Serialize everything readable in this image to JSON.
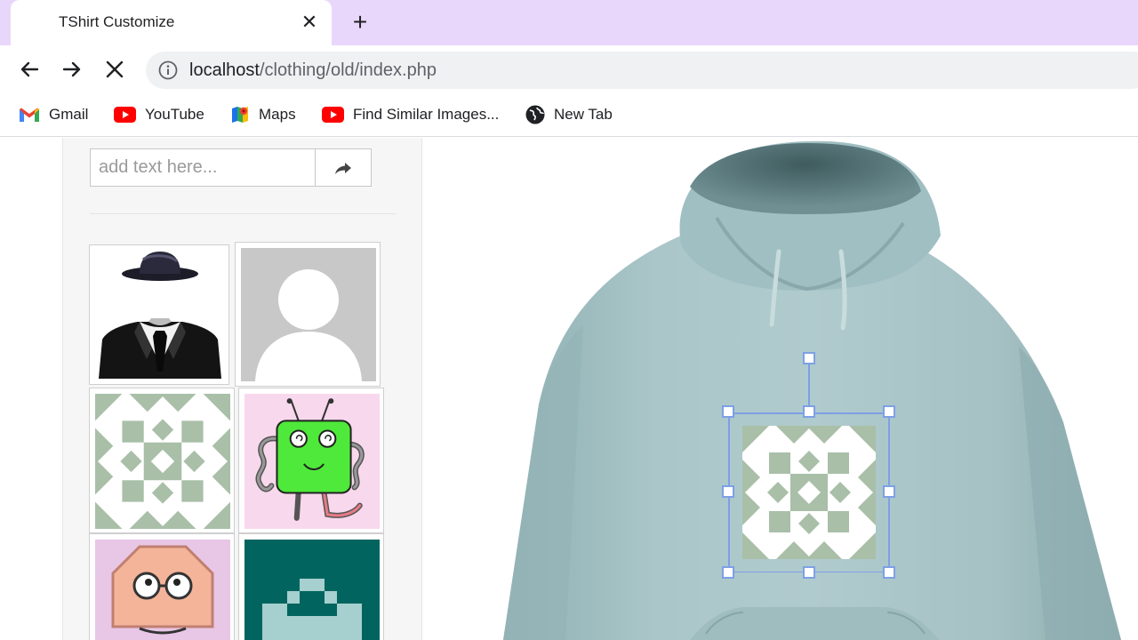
{
  "browser": {
    "tab_title": "TShirt Customize",
    "url_host": "localhost",
    "url_path": "/clothing/old/index.php",
    "bookmarks": [
      {
        "label": "Gmail",
        "icon": "gmail-icon"
      },
      {
        "label": "YouTube",
        "icon": "youtube-icon"
      },
      {
        "label": "Maps",
        "icon": "maps-icon"
      },
      {
        "label": "Find Similar Images...",
        "icon": "youtube-icon"
      },
      {
        "label": "New Tab",
        "icon": "globe-icon"
      }
    ]
  },
  "editor": {
    "text_placeholder": "add text here...",
    "text_value": "",
    "gallery": [
      {
        "name": "gentleman-suit-hat-image"
      },
      {
        "name": "default-avatar-image"
      },
      {
        "name": "green-quilt-pattern-image"
      },
      {
        "name": "green-monster-image"
      },
      {
        "name": "octagon-face-image"
      },
      {
        "name": "teal-pixel-pattern-image"
      }
    ],
    "product": "hoodie",
    "garment_color": "#a9c4c6",
    "selected_design": "green-quilt-pattern-image"
  },
  "colors": {
    "tabstrip": "#e9d7fb",
    "selection_handles": "#7da0e6",
    "quilt_green": "#a9bfa8"
  }
}
